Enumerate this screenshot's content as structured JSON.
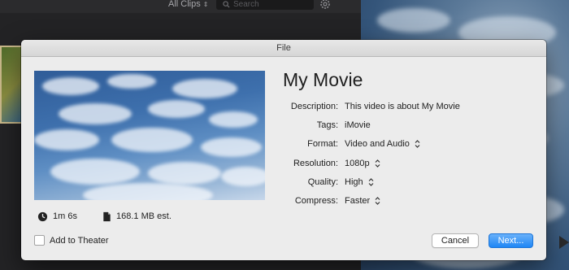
{
  "background": {
    "filter_label": "All Clips",
    "search_placeholder": "Search"
  },
  "dialog": {
    "title": "File",
    "movie_title": "My Movie",
    "duration": "1m 6s",
    "file_size": "168.1 MB est.",
    "fields": [
      {
        "label": "Description:",
        "value": "This video is about My Movie"
      },
      {
        "label": "Tags:",
        "value": "iMovie"
      },
      {
        "label": "Format:",
        "value": "Video and Audio"
      },
      {
        "label": "Resolution:",
        "value": "1080p"
      },
      {
        "label": "Quality:",
        "value": "High"
      },
      {
        "label": "Compress:",
        "value": "Faster"
      }
    ],
    "add_to_theater_label": "Add to Theater",
    "add_to_theater_checked": false,
    "cancel_label": "Cancel",
    "next_label": "Next..."
  },
  "colors": {
    "accent": "#1f86f5",
    "dialog_background": "#ececec"
  },
  "icons": [
    "chevron-updown-icon",
    "search-icon",
    "gear-icon",
    "clock-icon",
    "document-icon",
    "play-icon"
  ]
}
